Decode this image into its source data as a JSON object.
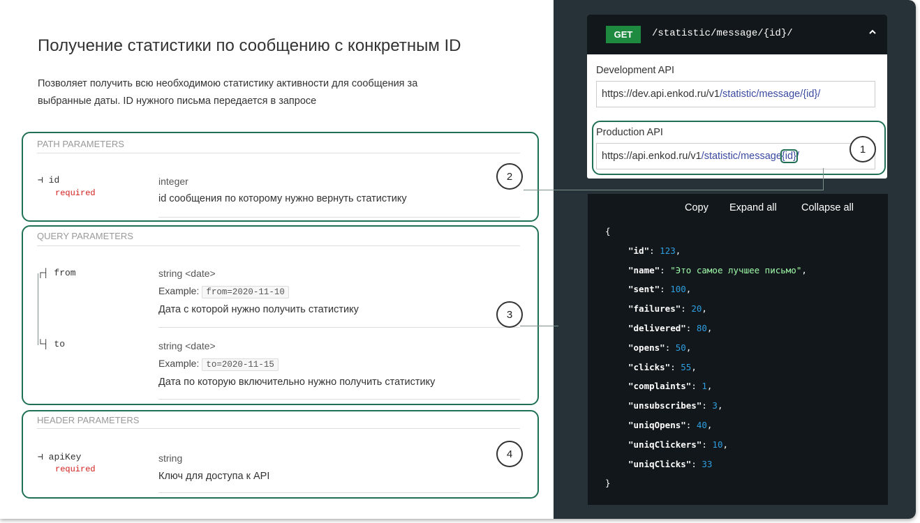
{
  "title": "Получение статистики по сообщению с конкретным ID",
  "description_line1": "Позволяет получить всю необходимою статистику активности для сообщения за",
  "description_line2": "выбранные даты. ID нужного письма передается в запросе",
  "path_params": {
    "section_title": "PATH PARAMETERS",
    "params": [
      {
        "name": "id",
        "required": "required",
        "type": "integer",
        "description": "id сообщения по которому нужно вернуть статистику"
      }
    ]
  },
  "query_params": {
    "section_title": "QUERY PARAMETERS",
    "params": [
      {
        "name": "from",
        "type": "string <date>",
        "example_label": "Example:",
        "example_value": "from=2020-11-10",
        "description": "Дата с которой нужно получить статистику"
      },
      {
        "name": "to",
        "type": "string <date>",
        "example_label": "Example:",
        "example_value": "to=2020-11-15",
        "description": "Дата по которую включительно нужно получить статистику"
      }
    ]
  },
  "header_params": {
    "section_title": "HEADER PARAMETERS",
    "params": [
      {
        "name": "apiKey",
        "required": "required",
        "type": "string",
        "description": "Ключ для доступа к API"
      }
    ]
  },
  "callouts": [
    "1",
    "2",
    "3",
    "4"
  ],
  "endpoint": {
    "method": "GET",
    "path": "/statistic/message/{id}/",
    "chevron_icon": "chevron-up-icon",
    "development": {
      "label": "Development API",
      "base": "https://dev.api.enkod.ru/v1",
      "path": "/statistic/message/{id}/"
    },
    "production": {
      "label": "Production API",
      "base": "https://api.enkod.ru/v1",
      "path": "/statistic/message",
      "id_part": "{id}",
      "trail": "/"
    }
  },
  "json_toolbar": {
    "copy": "Copy",
    "expand": "Expand all",
    "collapse": "Collapse all"
  },
  "json_sample": {
    "open": "{",
    "close": "}",
    "entries": [
      {
        "key": "\"id\"",
        "value": "123",
        "kind": "number"
      },
      {
        "key": "\"name\"",
        "value": "\"Это самое лучшее письмо\"",
        "kind": "string"
      },
      {
        "key": "\"sent\"",
        "value": "100",
        "kind": "number"
      },
      {
        "key": "\"failures\"",
        "value": "20",
        "kind": "number"
      },
      {
        "key": "\"delivered\"",
        "value": "80",
        "kind": "number"
      },
      {
        "key": "\"opens\"",
        "value": "50",
        "kind": "number"
      },
      {
        "key": "\"clicks\"",
        "value": "55",
        "kind": "number"
      },
      {
        "key": "\"complaints\"",
        "value": "1",
        "kind": "number"
      },
      {
        "key": "\"unsubscribes\"",
        "value": "3",
        "kind": "number"
      },
      {
        "key": "\"uniqOpens\"",
        "value": "40",
        "kind": "number"
      },
      {
        "key": "\"uniqClickers\"",
        "value": "10",
        "kind": "number"
      },
      {
        "key": "\"uniqClicks\"",
        "value": "33",
        "kind": "number",
        "last": true
      }
    ]
  },
  "colors": {
    "highlight_border": "#207058",
    "panel_bg": "#263238",
    "code_bg": "#11171a",
    "get_bg": "#1e8a3f",
    "required": "#d41f1c",
    "number": "#2e9ee0",
    "string": "#a0fbaa"
  }
}
